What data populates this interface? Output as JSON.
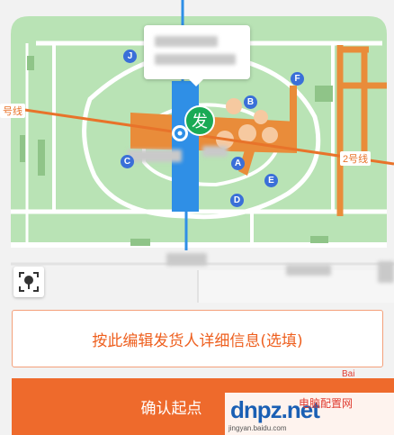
{
  "map": {
    "colors": {
      "park": "#b9e3b5",
      "road": "#ffffff",
      "metro_line_2": "#e8732a",
      "station_highlight": "#2f8fe6",
      "station_body": "#e98c3a"
    },
    "metro_labels": {
      "left": "号线",
      "right": "2号线"
    },
    "station_exits": [
      "J",
      "B",
      "F",
      "C",
      "A",
      "E",
      "D"
    ],
    "pin_label": "发"
  },
  "callout": {
    "redacted": true
  },
  "locate_control": {
    "icon": "locate-icon"
  },
  "edit_button": {
    "label": "按此编辑发货人详细信息(选填)"
  },
  "confirm_button": {
    "label": "确认起点"
  },
  "watermark": {
    "logo_text": "dnpz.net",
    "title": "电脑配置网",
    "url": "jingyan.baidu.com"
  },
  "baidu_mark": {
    "text": "Bai"
  }
}
